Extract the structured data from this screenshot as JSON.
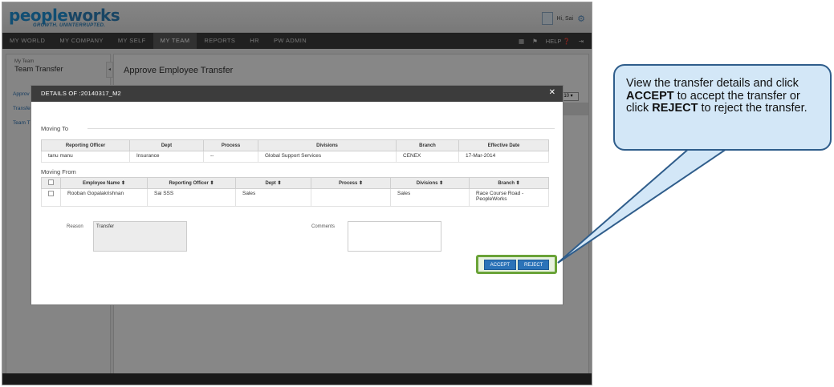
{
  "brand": {
    "name_part1": "people",
    "name_part2": "works",
    "tagline": "GROWTH. UNINTERRUPTED."
  },
  "user": {
    "greeting": "Hi, Sai"
  },
  "nav": {
    "items": [
      "MY WORLD",
      "MY COMPANY",
      "MY SELF",
      "MY TEAM",
      "REPORTS",
      "HR",
      "PW ADMIN"
    ],
    "active": "MY TEAM",
    "help_label": "HELP"
  },
  "sidebar": {
    "breadcrumb": "My Team",
    "title": "Team Transfer",
    "links": [
      "Approv",
      "Transfe",
      "Team T"
    ]
  },
  "page": {
    "title": "Approve Employee Transfer",
    "page_size": "10"
  },
  "modal": {
    "title": "DETAILS OF :20140317_M2",
    "moving_to": {
      "label": "Moving To",
      "headers": [
        "Reporting Officer",
        "Dept",
        "Process",
        "Divisions",
        "Branch",
        "Effective Date"
      ],
      "row": [
        "tanu manu",
        "Insurance",
        "--",
        "Global Support Services",
        "CENEX",
        "17-Mar-2014"
      ]
    },
    "moving_from": {
      "label": "Moving From",
      "headers": [
        "Employee Name",
        "Reporting Officer",
        "Dept",
        "Process",
        "Divisions",
        "Branch"
      ],
      "row": [
        "Rooban Gopalakrishnan",
        "Sai SSS",
        "Sales",
        "",
        "Sales",
        "Race Course Road - PeopleWorks"
      ]
    },
    "reason_label": "Reason",
    "reason_value": "Transfer",
    "comments_label": "Comments",
    "comments_value": "",
    "accept_label": "ACCEPT",
    "reject_label": "REJECT"
  },
  "callout": {
    "t1": "View the transfer details and click ",
    "b1": "ACCEPT",
    "t2": " to accept the transfer or click ",
    "b2": "REJECT",
    "t3": " to reject the transfer."
  },
  "colors": {
    "accent": "#2b73b8",
    "highlight": "#6aa338",
    "callout_fill": "#d3e7f7",
    "callout_border": "#2f5d8b"
  }
}
